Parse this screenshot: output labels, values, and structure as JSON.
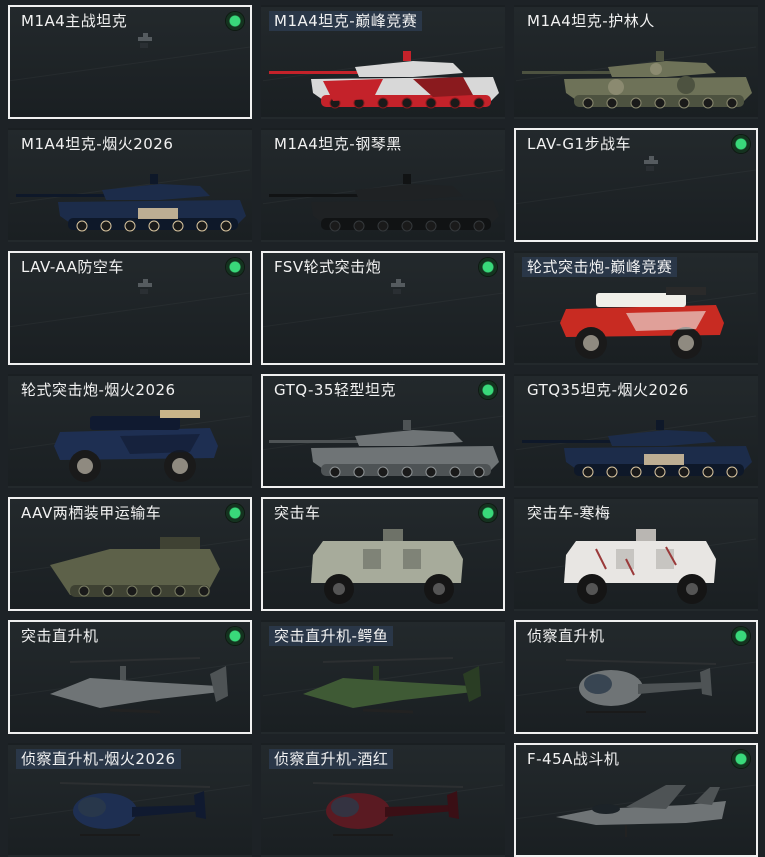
{
  "colors": {
    "selected_border": "#f0f0f0",
    "check_green": "#39d97a",
    "label_highlight": "#2a3748"
  },
  "items": [
    {
      "label": "M1A4主战坦克",
      "selected": true,
      "checked": true,
      "kind": "tank",
      "paint": "dark-small",
      "highlight": false
    },
    {
      "label": "M1A4坦克-巅峰竞赛",
      "selected": false,
      "checked": false,
      "kind": "tank",
      "paint": "red-white",
      "highlight": true
    },
    {
      "label": "M1A4坦克-护林人",
      "selected": false,
      "checked": false,
      "kind": "tank",
      "paint": "camo",
      "highlight": false
    },
    {
      "label": "M1A4坦克-烟火2026",
      "selected": false,
      "checked": false,
      "kind": "tank",
      "paint": "blue-2026",
      "highlight": false
    },
    {
      "label": "M1A4坦克-钢琴黑",
      "selected": false,
      "checked": false,
      "kind": "tank",
      "paint": "black",
      "highlight": false
    },
    {
      "label": "LAV-G1步战车",
      "selected": true,
      "checked": true,
      "kind": "small",
      "paint": "dark-small",
      "highlight": false
    },
    {
      "label": "LAV-AA防空车",
      "selected": true,
      "checked": true,
      "kind": "small",
      "paint": "dark-small",
      "highlight": false
    },
    {
      "label": "FSV轮式突击炮",
      "selected": true,
      "checked": true,
      "kind": "small",
      "paint": "dark-small",
      "highlight": false
    },
    {
      "label": "轮式突击炮-巅峰竞赛",
      "selected": false,
      "checked": false,
      "kind": "wheeled",
      "paint": "red",
      "highlight": true
    },
    {
      "label": "轮式突击炮-烟火2026",
      "selected": false,
      "checked": false,
      "kind": "wheeled",
      "paint": "blue",
      "highlight": false
    },
    {
      "label": "GTQ-35轻型坦克",
      "selected": true,
      "checked": true,
      "kind": "tank",
      "paint": "grey",
      "highlight": false
    },
    {
      "label": "GTQ35坦克-烟火2026",
      "selected": false,
      "checked": false,
      "kind": "tank",
      "paint": "blue-2026",
      "highlight": false
    },
    {
      "label": "AAV两栖装甲运输车",
      "selected": true,
      "checked": true,
      "kind": "amphib",
      "paint": "olive",
      "highlight": false
    },
    {
      "label": "突击车",
      "selected": true,
      "checked": true,
      "kind": "mrap",
      "paint": "green-grey",
      "highlight": false
    },
    {
      "label": "突击车-寒梅",
      "selected": false,
      "checked": false,
      "kind": "mrap",
      "paint": "white",
      "highlight": false
    },
    {
      "label": "突击直升机",
      "selected": true,
      "checked": true,
      "kind": "apache",
      "paint": "grey",
      "highlight": false
    },
    {
      "label": "突击直升机-鳄鱼",
      "selected": false,
      "checked": false,
      "kind": "apache",
      "paint": "green",
      "highlight": true
    },
    {
      "label": "侦察直升机",
      "selected": true,
      "checked": true,
      "kind": "littlebird",
      "paint": "grey",
      "highlight": false
    },
    {
      "label": "侦察直升机-烟火2026",
      "selected": false,
      "checked": false,
      "kind": "littlebird",
      "paint": "blue",
      "highlight": true
    },
    {
      "label": "侦察直升机-酒红",
      "selected": false,
      "checked": false,
      "kind": "littlebird",
      "paint": "burgundy",
      "highlight": true
    },
    {
      "label": "F-45A战斗机",
      "selected": true,
      "checked": true,
      "kind": "jet",
      "paint": "grey",
      "highlight": false
    }
  ]
}
